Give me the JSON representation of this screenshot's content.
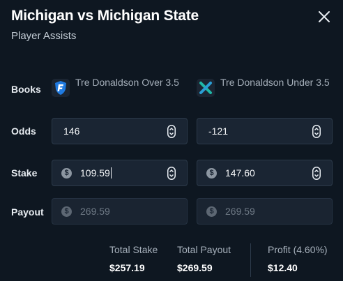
{
  "header": {
    "title": "Michigan vs Michigan State",
    "subtitle": "Player Assists"
  },
  "rows": {
    "books_label": "Books",
    "odds_label": "Odds",
    "stake_label": "Stake",
    "payout_label": "Payout"
  },
  "books": [
    {
      "name": "Tre Donaldson Over 3.5",
      "logo_icon": "fanduel-shield-logo",
      "color": "#1f7ae0"
    },
    {
      "name": "Tre Donaldson Under 3.5",
      "logo_icon": "x-logo",
      "color": "#1fb8a8"
    }
  ],
  "odds": [
    "146",
    "-121"
  ],
  "stakes": [
    "109.59",
    "147.60"
  ],
  "payouts": [
    "269.59",
    "269.59"
  ],
  "currency_symbol": "$",
  "summary": {
    "total_stake_label": "Total Stake",
    "total_stake_value": "$257.19",
    "total_payout_label": "Total Payout",
    "total_payout_value": "$269.59",
    "profit_label": "Profit (4.60%)",
    "profit_value": "$12.40"
  }
}
